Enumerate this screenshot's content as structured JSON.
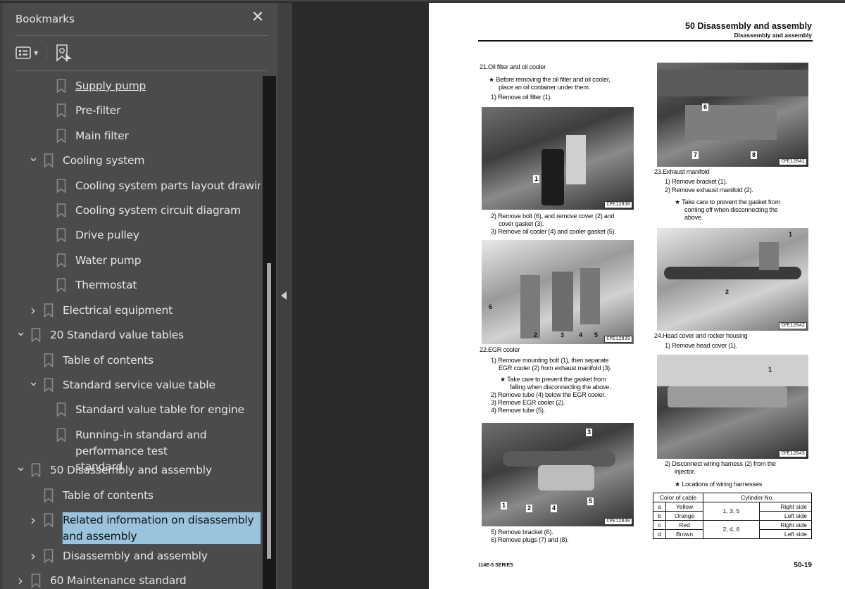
{
  "sidebar": {
    "title": "Bookmarks",
    "close_icon": "close-icon",
    "toolbar": {
      "options_icon": "list-options-icon",
      "find_bookmark_icon": "find-current-bookmark-icon"
    },
    "items": [
      {
        "label": "Supply pump ",
        "level": 2,
        "expander": "none",
        "underline": true
      },
      {
        "label": "Pre-filter",
        "level": 2,
        "expander": "none"
      },
      {
        "label": "Main filter",
        "level": 2,
        "expander": "none"
      },
      {
        "label": "Cooling system",
        "level": 1,
        "expander": "expanded"
      },
      {
        "label": "Cooling system parts layout drawing",
        "level": 2,
        "expander": "none"
      },
      {
        "label": "Cooling system circuit diagram",
        "level": 2,
        "expander": "none"
      },
      {
        "label": "Drive pulley",
        "level": 2,
        "expander": "none"
      },
      {
        "label": "Water pump",
        "level": 2,
        "expander": "none"
      },
      {
        "label": "Thermostat",
        "level": 2,
        "expander": "none"
      },
      {
        "label": "Electrical equipment",
        "level": 1,
        "expander": "collapsed"
      },
      {
        "label": "20 Standard value tables",
        "level": 0,
        "expander": "expanded"
      },
      {
        "label": "Table of contents",
        "level": 1,
        "expander": "none"
      },
      {
        "label": "Standard service value table",
        "level": 1,
        "expander": "expanded"
      },
      {
        "label": "Standard value table for engine",
        "level": 2,
        "expander": "none"
      },
      {
        "label": "Running-in standard and performance test standard",
        "level": 2,
        "expander": "none"
      },
      {
        "label": "50 Disassembly and assembly",
        "level": 0,
        "expander": "expanded"
      },
      {
        "label": "Table of contents",
        "level": 1,
        "expander": "none"
      },
      {
        "label": "Related information on disassembly and assembly",
        "level": 1,
        "expander": "collapsed",
        "selected": true
      },
      {
        "label": "Disassembly and assembly",
        "level": 1,
        "expander": "collapsed"
      },
      {
        "label": "60 Maintenance standard",
        "level": 0,
        "expander": "collapsed"
      }
    ],
    "selected_color": "#9ac4de"
  },
  "document": {
    "header_title": "50 Disassembly and assembly",
    "header_subtitle": "Disassembly and assembly",
    "left_column": {
      "sec21_title": "21.Oil filter and oil cooler",
      "sec21_note": "★  Before removing the oil filter and oil cooler,",
      "sec21_note2": "place an oil container under them.",
      "sec21_step1": "1)  Remove oil filter (1).",
      "fig1_code": "CPE12838",
      "fig1_callouts": [
        "1"
      ],
      "sec21_step2a": "2)  Remove bolt (6), and remove cover (2) and",
      "sec21_step2b": "cover gasket (3).",
      "sec21_step3": "3)  Remove oil cooler (4) and cooler gasket (5).",
      "fig2_code": "CPE12839",
      "fig2_callouts": [
        "6",
        "2",
        "3",
        "4",
        "5"
      ],
      "sec22_title": "22.EGR cooler",
      "sec22_step1a": "1)  Remove mounting bolt (1), then separate",
      "sec22_step1b": "EGR cooler (2) from exhaust manifold (3).",
      "sec22_note_a": "★  Take care to prevent the gasket from",
      "sec22_note_b": "falling when disconnecting the above.",
      "sec22_step2": "2)  Remove tube (4) below the EGR cooler.",
      "sec22_step3": "3)  Remove EGR cooler (2).",
      "sec22_step4": "4)  Remove tube (5).",
      "fig3_code": "CPE12840",
      "fig3_callouts": [
        "3",
        "1",
        "2",
        "4",
        "5"
      ],
      "sec22_step5": "5)  Remove bracket (6).",
      "sec22_step6": "6)  Remove plugs (7) and (8)."
    },
    "right_column": {
      "fig4_code": "CPE12841",
      "fig4_callouts": [
        "6",
        "7",
        "8"
      ],
      "sec23_title": "23.Exhaust manifold",
      "sec23_step1": "1)  Remove bracket (1).",
      "sec23_step2": "2)  Remove exhaust manifold (2).",
      "sec23_note_a": "★  Take care to prevent the gasket from",
      "sec23_note_b": "coming off when disconnecting the",
      "sec23_note_c": "above.",
      "fig5_code": "CPE12842",
      "fig5_callouts": [
        "1",
        "2"
      ],
      "sec24_title": "24.Head cover and rocker housing",
      "sec24_step1": "1)  Remove head cover (1).",
      "fig6_code": "CPE12843",
      "fig6_callouts": [
        "1"
      ],
      "sec24_step2a": "2)  Disconnect wiring harness (2) from the",
      "sec24_step2b": "injector.",
      "sec24_note": "★  Locations of wiring harnesses",
      "table": {
        "headers": [
          "Color of cable",
          "Cylinder No."
        ],
        "rows": [
          {
            "key": "a",
            "color": "Yellow",
            "cylinders": "1, 3, 5",
            "side": "Right side"
          },
          {
            "key": "b",
            "color": "Orange",
            "cylinders": "1, 3, 5",
            "side": "Left side"
          },
          {
            "key": "c",
            "color": "Red",
            "cylinders": "2, 4, 6",
            "side": "Right side"
          },
          {
            "key": "d",
            "color": "Brown",
            "cylinders": "2, 4, 6",
            "side": "Left side"
          }
        ]
      }
    },
    "footer_left": "114E-5 SERIES",
    "footer_right": "50-19"
  }
}
